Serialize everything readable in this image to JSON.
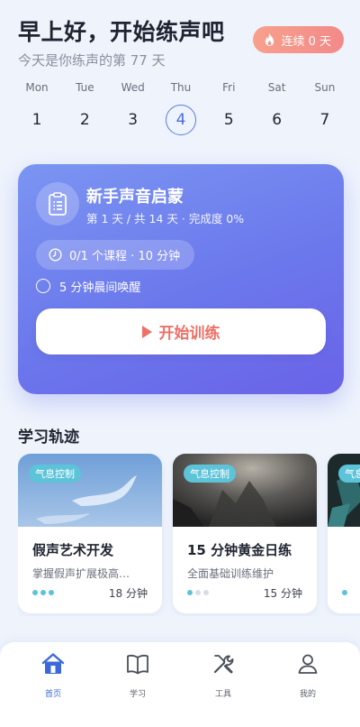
{
  "header": {
    "greeting": "早上好，开始练声吧",
    "subtitle": "今天是你练声的第 77 天",
    "streak_label": "连续 0 天"
  },
  "week": [
    {
      "name": "Mon",
      "num": "1"
    },
    {
      "name": "Tue",
      "num": "2"
    },
    {
      "name": "Wed",
      "num": "3"
    },
    {
      "name": "Thu",
      "num": "4"
    },
    {
      "name": "Fri",
      "num": "5"
    },
    {
      "name": "Sat",
      "num": "6"
    },
    {
      "name": "Sun",
      "num": "7"
    }
  ],
  "plan": {
    "title": "新手声音启蒙",
    "meta": "第 1 天 / 共 14 天 · 完成度 0%",
    "lesson_info": "0/1 个课程 · 10 分钟",
    "task": "5 分钟晨间唤醒",
    "start_label": "开始训练"
  },
  "section_title": "学习轨迹",
  "courses": [
    {
      "tag": "气息控制",
      "title": "假声艺术开发",
      "desc": "掌握假声扩展极高…",
      "duration": "18 分钟",
      "progress_dots": 3
    },
    {
      "tag": "气息控制",
      "title": "15 分钟黄金日练",
      "desc": "全面基础训练维护",
      "duration": "15 分钟",
      "progress_dots": 1
    },
    {
      "tag": "气息控制",
      "title": "",
      "desc": "",
      "duration": "",
      "progress_dots": 1
    }
  ],
  "tabbar": [
    {
      "label": "首页",
      "icon": "home-icon",
      "active": true
    },
    {
      "label": "学习",
      "icon": "book-icon",
      "active": false
    },
    {
      "label": "工具",
      "icon": "tools-icon",
      "active": false
    },
    {
      "label": "我的",
      "icon": "profile-icon",
      "active": false
    }
  ],
  "colors": {
    "accent": "#5b7be9",
    "streak": "#f38a8a",
    "start_text": "#ee6f66",
    "tag": "#5cc3d9"
  }
}
